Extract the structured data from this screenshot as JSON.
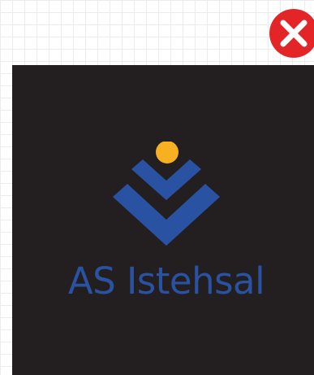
{
  "close_button": {
    "icon": "close-icon",
    "color": "#e42527"
  },
  "logo": {
    "name": "AS Istehsal",
    "brand_blue": "#2a52a2",
    "accent_yellow": "#f6b021",
    "panel_color": "#231f20"
  }
}
